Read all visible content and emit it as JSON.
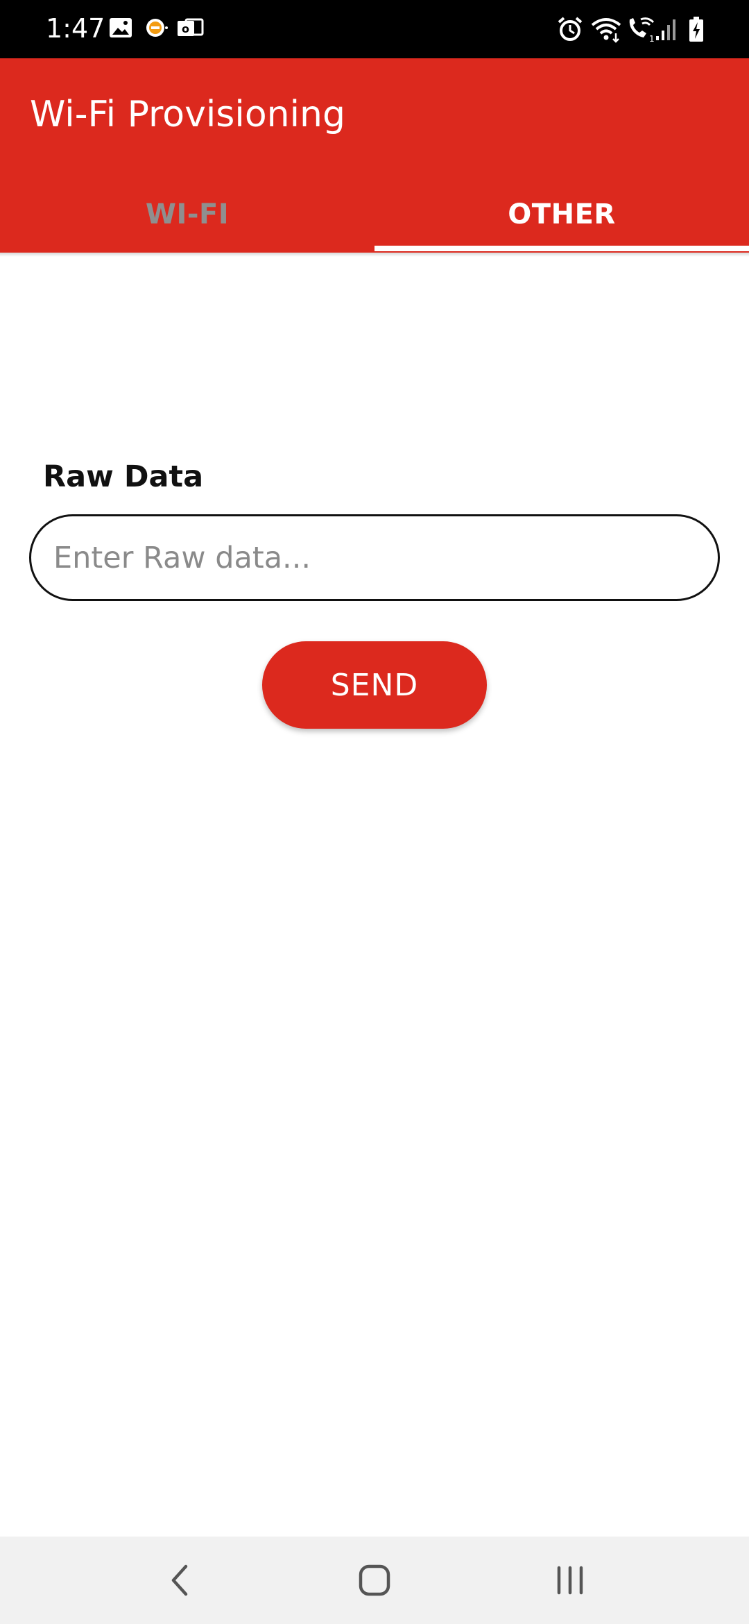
{
  "status_bar": {
    "time": "1:47",
    "left_icons": [
      "image-icon",
      "notification-icon",
      "mail-icon"
    ],
    "right_icons": [
      "alarm-icon",
      "wifi-icon",
      "wifi-calling-icon",
      "signal-icon",
      "battery-icon"
    ]
  },
  "app_bar": {
    "title": "Wi-Fi Provisioning",
    "tabs": [
      {
        "label": "WI-FI",
        "selected": false
      },
      {
        "label": "OTHER",
        "selected": true
      }
    ]
  },
  "form": {
    "raw_data_label": "Raw Data",
    "raw_data_placeholder": "Enter Raw data...",
    "raw_data_value": "",
    "send_label": "SEND"
  },
  "nav_bar": {
    "buttons": [
      "back-icon",
      "home-icon",
      "recents-icon"
    ]
  },
  "colors": {
    "accent": "#dc291e",
    "tab_inactive": "#8f8f8f",
    "status_bar": "#000000",
    "nav_bar": "#f1f1f1"
  }
}
